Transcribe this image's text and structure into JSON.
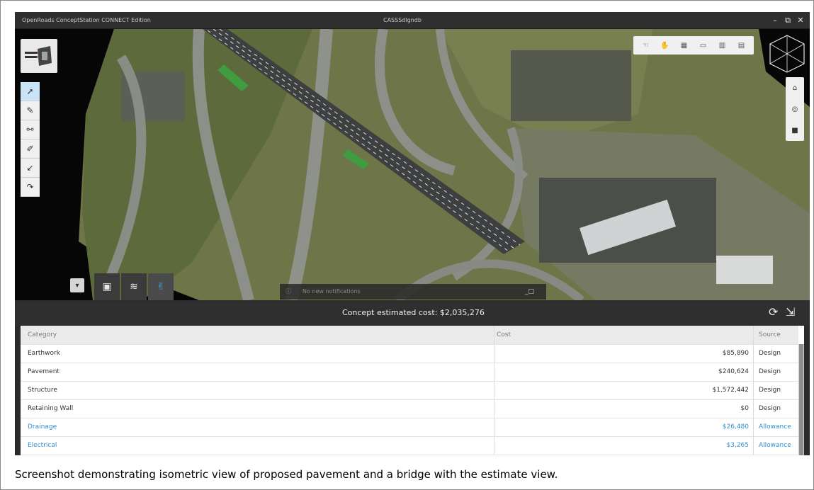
{
  "window": {
    "app_title": "OpenRoads ConceptStation CONNECT Edition",
    "file_name": "CASSSdlgndb",
    "minimize": "–",
    "restore": "⧉",
    "close": "✕"
  },
  "viewport": {
    "search_text": "No new notifications"
  },
  "estimate": {
    "total_text": "Concept estimated cost: $2,035,276",
    "columns": [
      "Category",
      "Cost",
      "Source"
    ],
    "rows": [
      {
        "category": "Earthwork",
        "cost": "$85,890",
        "source": "Design",
        "style": "normal"
      },
      {
        "category": "Pavement",
        "cost": "$240,624",
        "source": "Design",
        "style": "normal"
      },
      {
        "category": "Structure",
        "cost": "$1,572,442",
        "source": "Design",
        "style": "normal"
      },
      {
        "category": "Retaining Wall",
        "cost": "$0",
        "source": "Design",
        "style": "normal"
      },
      {
        "category": "Drainage",
        "cost": "$26,480",
        "source": "Allowance",
        "style": "link"
      },
      {
        "category": "Electrical",
        "cost": "$3,265",
        "source": "Allowance",
        "style": "link"
      }
    ]
  },
  "caption": "Screenshot demonstrating isometric view of proposed pavement and a bridge with the estimate view.",
  "colors": {
    "accent": "#2f8fd0",
    "toolbar_bg": "#2f2f2f"
  }
}
